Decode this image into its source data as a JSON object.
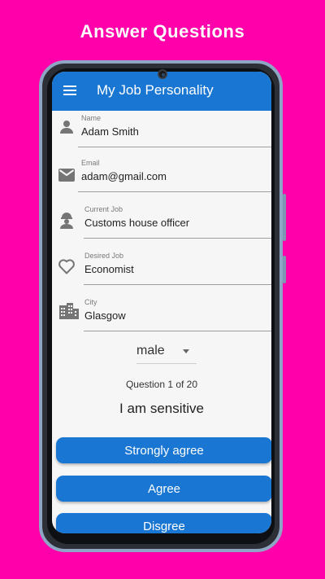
{
  "promo": {
    "title": "Answer Questions"
  },
  "app": {
    "title": "My Job Personality",
    "menu_icon": "menu-icon",
    "accent_color": "#1976d2",
    "background_color": "#FF00AA"
  },
  "form": {
    "name": {
      "label": "Name",
      "value": "Adam Smith",
      "icon": "person-icon"
    },
    "email": {
      "label": "Email",
      "value": "adam@gmail.com",
      "icon": "mail-icon"
    },
    "current_job": {
      "label": "Current Job",
      "value": "Customs house officer",
      "icon": "worker-icon"
    },
    "desired_job": {
      "label": "Desired Job",
      "value": "Economist",
      "icon": "heart-icon"
    },
    "city": {
      "label": "City",
      "value": "Glasgow",
      "icon": "city-icon"
    },
    "gender": {
      "value": "male",
      "icon": "dropdown-arrow-icon"
    }
  },
  "question": {
    "counter": "Question 1 of 20",
    "text": "I am sensitive"
  },
  "answers": [
    {
      "label": "Strongly agree"
    },
    {
      "label": "Agree"
    },
    {
      "label": "Disgree"
    }
  ]
}
